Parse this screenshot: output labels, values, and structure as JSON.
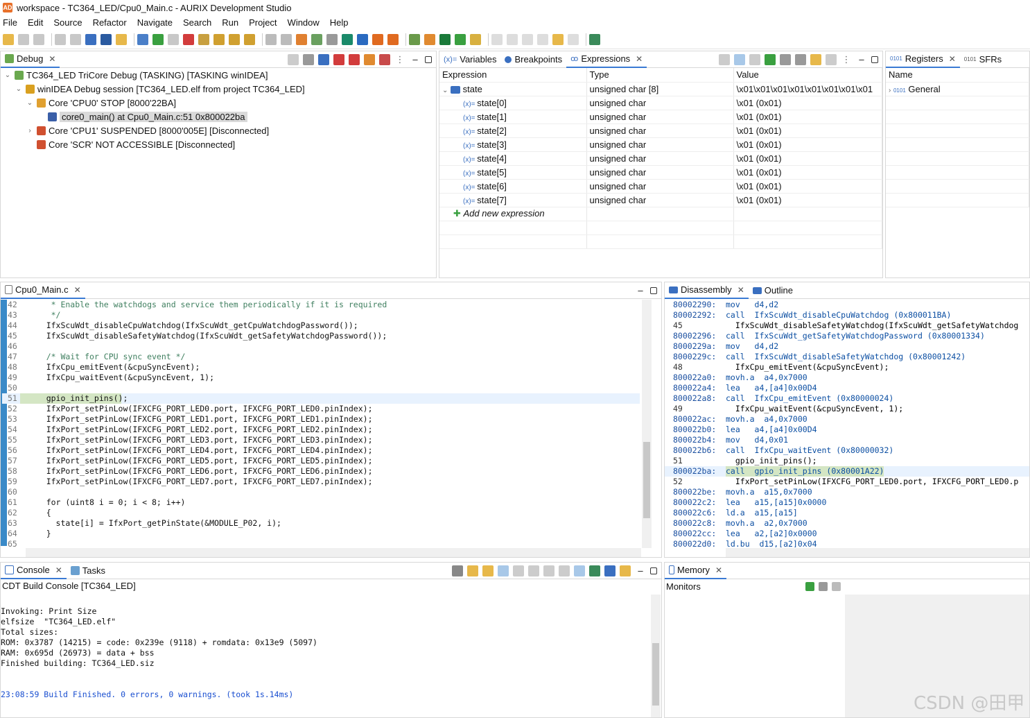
{
  "window": {
    "title": "workspace - TC364_LED/Cpu0_Main.c - AURIX Development Studio"
  },
  "menu": [
    "File",
    "Edit",
    "Source",
    "Refactor",
    "Navigate",
    "Search",
    "Run",
    "Project",
    "Window",
    "Help"
  ],
  "debug_view": {
    "tab": "Debug",
    "tree": [
      {
        "level": 0,
        "text": "TC364_LED TriCore Debug (TASKING) [TASKING winIDEA]",
        "icon": "launch-config-icon",
        "color": "#6aa84f"
      },
      {
        "level": 1,
        "text": "winIDEA Debug session [TC364_LED.elf from project TC364_LED]",
        "icon": "debug-session-icon",
        "color": "#d9a020"
      },
      {
        "level": 2,
        "text": "Core 'CPU0' STOP [8000'22BA]",
        "icon": "core-icon",
        "color": "#e0a030"
      },
      {
        "level": 3,
        "text": "core0_main() at Cpu0_Main.c:51 0x800022ba",
        "icon": "stack-frame-icon",
        "color": "#3a5fa8",
        "selected": true
      },
      {
        "level": 2,
        "text": "Core 'CPU1' SUSPENDED [8000'005E] [Disconnected]",
        "icon": "core-icon",
        "color": "#d05030"
      },
      {
        "level": 2,
        "text": "Core 'SCR' NOT ACCESSIBLE [Disconnected]",
        "icon": "core-icon",
        "color": "#d05030"
      }
    ]
  },
  "expressions_view": {
    "tabs": [
      "Variables",
      "Breakpoints",
      "Expressions"
    ],
    "active_tab": "Expressions",
    "columns": [
      "Expression",
      "Type",
      "Value"
    ],
    "root": {
      "name": "state",
      "type": "unsigned char [8]",
      "value": "\\x01\\x01\\x01\\x01\\x01\\x01\\x01\\x01"
    },
    "children": [
      {
        "name": "state[0]",
        "type": "unsigned char",
        "value": "\\x01 (0x01)"
      },
      {
        "name": "state[1]",
        "type": "unsigned char",
        "value": "\\x01 (0x01)"
      },
      {
        "name": "state[2]",
        "type": "unsigned char",
        "value": "\\x01 (0x01)"
      },
      {
        "name": "state[3]",
        "type": "unsigned char",
        "value": "\\x01 (0x01)"
      },
      {
        "name": "state[4]",
        "type": "unsigned char",
        "value": "\\x01 (0x01)"
      },
      {
        "name": "state[5]",
        "type": "unsigned char",
        "value": "\\x01 (0x01)"
      },
      {
        "name": "state[6]",
        "type": "unsigned char",
        "value": "\\x01 (0x01)"
      },
      {
        "name": "state[7]",
        "type": "unsigned char",
        "value": "\\x01 (0x01)"
      }
    ],
    "add_label": "Add new expression"
  },
  "registers_view": {
    "tabs": [
      "Registers",
      "SFRs"
    ],
    "column": "Name",
    "items": [
      "General"
    ]
  },
  "editor": {
    "tab": "Cpu0_Main.c",
    "current_line": "51",
    "lines": [
      {
        "n": "42",
        "t": "     * Enable the watchdogs and service them periodically if it is required",
        "c": "cm"
      },
      {
        "n": "43",
        "t": "     */",
        "c": "cm"
      },
      {
        "n": "44",
        "t": "    IfxScuWdt_disableCpuWatchdog(IfxScuWdt_getCpuWatchdogPassword());",
        "c": ""
      },
      {
        "n": "45",
        "t": "    IfxScuWdt_disableSafetyWatchdog(IfxScuWdt_getSafetyWatchdogPassword());",
        "c": ""
      },
      {
        "n": "46",
        "t": "",
        "c": ""
      },
      {
        "n": "47",
        "t": "    /* Wait for CPU sync event */",
        "c": "cm"
      },
      {
        "n": "48",
        "t": "    IfxCpu_emitEvent(&cpuSyncEvent);",
        "c": ""
      },
      {
        "n": "49",
        "t": "    IfxCpu_waitEvent(&cpuSyncEvent, 1);",
        "c": ""
      },
      {
        "n": "50",
        "t": "",
        "c": ""
      },
      {
        "n": "51",
        "t": "    gpio_init_pins();",
        "c": ""
      },
      {
        "n": "52",
        "t": "    IfxPort_setPinLow(IFXCFG_PORT_LED0.port, IFXCFG_PORT_LED0.pinIndex);",
        "c": ""
      },
      {
        "n": "53",
        "t": "    IfxPort_setPinLow(IFXCFG_PORT_LED1.port, IFXCFG_PORT_LED1.pinIndex);",
        "c": ""
      },
      {
        "n": "54",
        "t": "    IfxPort_setPinLow(IFXCFG_PORT_LED2.port, IFXCFG_PORT_LED2.pinIndex);",
        "c": ""
      },
      {
        "n": "55",
        "t": "    IfxPort_setPinLow(IFXCFG_PORT_LED3.port, IFXCFG_PORT_LED3.pinIndex);",
        "c": ""
      },
      {
        "n": "56",
        "t": "    IfxPort_setPinLow(IFXCFG_PORT_LED4.port, IFXCFG_PORT_LED4.pinIndex);",
        "c": ""
      },
      {
        "n": "57",
        "t": "    IfxPort_setPinLow(IFXCFG_PORT_LED5.port, IFXCFG_PORT_LED5.pinIndex);",
        "c": ""
      },
      {
        "n": "58",
        "t": "    IfxPort_setPinLow(IFXCFG_PORT_LED6.port, IFXCFG_PORT_LED6.pinIndex);",
        "c": ""
      },
      {
        "n": "59",
        "t": "    IfxPort_setPinLow(IFXCFG_PORT_LED7.port, IFXCFG_PORT_LED7.pinIndex);",
        "c": ""
      },
      {
        "n": "60",
        "t": "",
        "c": ""
      },
      {
        "n": "61",
        "t": "    for (uint8 i = 0; i < 8; i++)",
        "c": ""
      },
      {
        "n": "62",
        "t": "    {",
        "c": ""
      },
      {
        "n": "63",
        "t": "      state[i] = IfxPort_getPinState(&MODULE_P02, i);",
        "c": ""
      },
      {
        "n": "64",
        "t": "    }",
        "c": ""
      },
      {
        "n": "65",
        "t": "",
        "c": ""
      }
    ]
  },
  "disassembly": {
    "tabs": [
      "Disassembly",
      "Outline"
    ],
    "lines": [
      {
        "a": "80002290:",
        "t": "mov   d4,d2"
      },
      {
        "a": "80002292:",
        "t": "call  IfxScuWdt_disableCpuWatchdog (0x800011BA)"
      },
      {
        "a": "45",
        "t": "  IfxScuWdt_disableSafetyWatchdog(IfxScuWdt_getSafetyWatchdog",
        "src": true
      },
      {
        "a": "80002296:",
        "t": "call  IfxScuWdt_getSafetyWatchdogPassword (0x80001334)"
      },
      {
        "a": "8000229a:",
        "t": "mov   d4,d2"
      },
      {
        "a": "8000229c:",
        "t": "call  IfxScuWdt_disableSafetyWatchdog (0x80001242)"
      },
      {
        "a": "48",
        "t": "  IfxCpu_emitEvent(&cpuSyncEvent);",
        "src": true
      },
      {
        "a": "800022a0:",
        "t": "movh.a  a4,0x7000"
      },
      {
        "a": "800022a4:",
        "t": "lea   a4,[a4]0x00D4"
      },
      {
        "a": "800022a8:",
        "t": "call  IfxCpu_emitEvent (0x80000024)"
      },
      {
        "a": "49",
        "t": "  IfxCpu_waitEvent(&cpuSyncEvent, 1);",
        "src": true
      },
      {
        "a": "800022ac:",
        "t": "movh.a  a4,0x7000"
      },
      {
        "a": "800022b0:",
        "t": "lea   a4,[a4]0x00D4"
      },
      {
        "a": "800022b4:",
        "t": "mov   d4,0x01"
      },
      {
        "a": "800022b6:",
        "t": "call  IfxCpu_waitEvent (0x80000032)"
      },
      {
        "a": "51",
        "t": "  gpio_init_pins();",
        "src": true
      },
      {
        "a": "800022ba:",
        "t": "call  gpio_init_pins (0x80001A22)",
        "current": true
      },
      {
        "a": "52",
        "t": "  IfxPort_setPinLow(IFXCFG_PORT_LED0.port, IFXCFG_PORT_LED0.p",
        "src": true
      },
      {
        "a": "800022be:",
        "t": "movh.a  a15,0x7000"
      },
      {
        "a": "800022c2:",
        "t": "lea   a15,[a15]0x0000"
      },
      {
        "a": "800022c6:",
        "t": "ld.a  a15,[a15]"
      },
      {
        "a": "800022c8:",
        "t": "movh.a  a2,0x7000"
      },
      {
        "a": "800022cc:",
        "t": "lea   a2,[a2]0x0000"
      },
      {
        "a": "800022d0:",
        "t": "ld.bu  d15,[a2]0x04"
      }
    ]
  },
  "console": {
    "tabs": [
      "Console",
      "Tasks"
    ],
    "header": "CDT Build Console [TC364_LED]",
    "lines": [
      "Invoking: Print Size",
      "elfsize  \"TC364_LED.elf\"",
      "Total sizes:",
      "ROM: 0x3787 (14215) = code: 0x239e (9118) + romdata: 0x13e9 (5097)",
      "RAM: 0x695d (26973) = data + bss",
      "Finished building: TC364_LED.siz"
    ],
    "status": "23:08:59 Build Finished. 0 errors, 0 warnings. (took 1s.14ms)"
  },
  "memory_view": {
    "tab": "Memory",
    "header": "Monitors"
  },
  "watermark": "CSDN @田甲"
}
